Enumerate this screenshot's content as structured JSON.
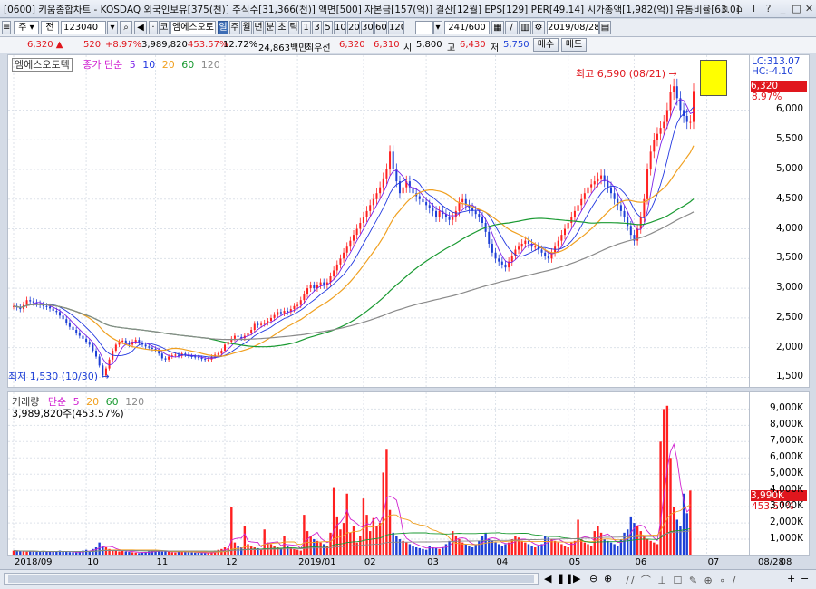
{
  "title_bar": {
    "text": "[0600] 키움종합차트 - KOSDAQ 외국인보유[375(천)] 주식수[31,366(천)] 액면[500] 자본금[157(억)] 결산[12월] EPS[129] PER[49.14] 시가총액[1,982(억)] 유통비율[63.0]",
    "number_label": "1"
  },
  "toolbar": {
    "type_select": "주",
    "all_select": "전",
    "code": "123040",
    "stock_name": "엠에스오토",
    "period_tabs": [
      "일",
      "주",
      "월",
      "년",
      "분",
      "초",
      "틱"
    ],
    "active_period": "일",
    "minute_options": [
      "1",
      "3",
      "5",
      "10",
      "20",
      "30",
      "60",
      "120"
    ],
    "range": "241/600",
    "date": "2019/08/28"
  },
  "quote": {
    "price": "6,320 ▲",
    "change": "520",
    "change_pct": "+8.97%",
    "volume": "3,989,820",
    "volume_ratio": "453.57%",
    "turnover": "12.72%",
    "amount": "24,863백만",
    "best_bid_label": "최우선",
    "best_ask": "6,320",
    "best_bid": "6,310",
    "open_label": "시",
    "open": "5,800",
    "high_label": "고",
    "high": "6,430",
    "low_label": "저",
    "low": "5,750",
    "buy_button": "매수",
    "sell_button": "매도"
  },
  "colors": {
    "up": "#ff2020",
    "down": "#1d3fd6",
    "ma5": "#7b21e8",
    "ma10": "#2137e0",
    "ma20": "#f0a020",
    "ma60": "#1a9a32",
    "ma120": "#8a8a8a",
    "vol_ma": "#d020d0"
  },
  "price_panel": {
    "stock_label": "엠에스오토텍",
    "ma_label": "종가 단순",
    "ma_periods": [
      "5",
      "10",
      "20",
      "60",
      "120"
    ],
    "lc_label": "LC:313.07",
    "hc_label": "HC:-4.10",
    "current_price_tag": "6,320",
    "current_pct_tag": "8.97%",
    "max_marker": "최고 6,590 (08/21)",
    "min_marker": "최저 1,530 (10/30)",
    "y_ticks": [
      "6,000",
      "5,500",
      "5,000",
      "4,500",
      "4,000",
      "3,500",
      "3,000",
      "2,500",
      "2,000",
      "1,500"
    ]
  },
  "volume_panel": {
    "label": "거래량",
    "ma_label": "단순",
    "ma_periods": [
      "5",
      "20",
      "60",
      "120"
    ],
    "current_value": "3,989,820주(453.57%)",
    "current_tag": "3,990K",
    "current_pct_tag": "453.57%",
    "y_ticks": [
      "9,000K",
      "8,000K",
      "7,000K",
      "6,000K",
      "5,000K",
      "4,000K",
      "3,000K",
      "2,000K",
      "1,000K"
    ]
  },
  "x_axis": {
    "labels": [
      "2018/09",
      "10",
      "11",
      "12",
      "2019/01",
      "02",
      "03",
      "04",
      "05",
      "06",
      "07",
      "08"
    ],
    "end_label": "08/28"
  },
  "chart_data": {
    "type": "candlestick",
    "period": "daily",
    "y_range": [
      1400,
      6800
    ],
    "volume_y_range_k": [
      0,
      9800
    ],
    "closes": [
      2700,
      2680,
      2650,
      2720,
      2800,
      2780,
      2760,
      2740,
      2720,
      2700,
      2690,
      2660,
      2620,
      2600,
      2540,
      2480,
      2420,
      2350,
      2300,
      2250,
      2200,
      2150,
      2100,
      2050,
      1950,
      1850,
      1700,
      1530,
      1650,
      1800,
      1950,
      2050,
      2100,
      2120,
      2080,
      2050,
      2100,
      2130,
      2080,
      2050,
      2020,
      2000,
      1980,
      1960,
      1900,
      1820,
      1800,
      1850,
      1870,
      1880,
      1860,
      1900,
      1880,
      1860,
      1850,
      1840,
      1830,
      1810,
      1800,
      1800,
      1850,
      1880,
      1900,
      1950,
      2050,
      2100,
      2150,
      2200,
      2180,
      2160,
      2200,
      2250,
      2300,
      2400,
      2380,
      2400,
      2420,
      2450,
      2500,
      2550,
      2600,
      2580,
      2620,
      2600,
      2650,
      2700,
      2720,
      2800,
      2900,
      3000,
      3050,
      3000,
      3050,
      3100,
      3050,
      3100,
      3200,
      3300,
      3400,
      3500,
      3600,
      3700,
      3800,
      3900,
      4000,
      4100,
      4200,
      4300,
      4400,
      4500,
      4600,
      4700,
      4850,
      5000,
      5300,
      5000,
      4800,
      4600,
      4700,
      4800,
      4700,
      4600,
      4550,
      4500,
      4450,
      4400,
      4350,
      4300,
      4200,
      4300,
      4250,
      4200,
      4150,
      4200,
      4300,
      4450,
      4500,
      4400,
      4350,
      4300,
      4250,
      4200,
      4100,
      3950,
      3750,
      3600,
      3500,
      3450,
      3400,
      3350,
      3450,
      3550,
      3650,
      3700,
      3750,
      3800,
      3750,
      3700,
      3700,
      3650,
      3600,
      3550,
      3500,
      3600,
      3700,
      3800,
      3900,
      4000,
      4100,
      4200,
      4300,
      4400,
      4500,
      4600,
      4700,
      4750,
      4800,
      4850,
      4900,
      4800,
      4700,
      4600,
      4500,
      4400,
      4300,
      4200,
      4050,
      3900,
      3800,
      4000,
      4200,
      4500,
      5000,
      5300,
      5500,
      5600,
      5700,
      5800,
      6000,
      6300,
      6400,
      6200,
      6000,
      5900,
      5800,
      5800,
      6320
    ],
    "volumes_k": [
      300,
      280,
      260,
      250,
      240,
      300,
      250,
      230,
      220,
      260,
      250,
      240,
      230,
      260,
      300,
      250,
      220,
      210,
      200,
      190,
      250,
      300,
      350,
      280,
      400,
      500,
      800,
      600,
      500,
      400,
      350,
      300,
      250,
      300,
      250,
      220,
      200,
      180,
      150,
      200,
      220,
      250,
      300,
      280,
      260,
      240,
      250,
      230,
      200,
      180,
      300,
      250,
      220,
      200,
      190,
      180,
      170,
      160,
      150,
      140,
      200,
      300,
      350,
      400,
      500,
      450,
      3000,
      800,
      600,
      500,
      1800,
      700,
      600,
      500,
      450,
      400,
      1600,
      800,
      700,
      600,
      500,
      450,
      1200,
      600,
      500,
      400,
      350,
      300,
      2500,
      1500,
      1200,
      1000,
      900,
      800,
      700,
      600,
      1400,
      4200,
      2400,
      1600,
      2000,
      3800,
      1400,
      1800,
      800,
      1200,
      3500,
      2500,
      1500,
      2300,
      1800,
      2000,
      5100,
      6500,
      2800,
      1400,
      1200,
      1000,
      900,
      800,
      700,
      600,
      500,
      450,
      400,
      350,
      600,
      500,
      450,
      400,
      500,
      700,
      900,
      1500,
      1200,
      1000,
      800,
      700,
      600,
      500,
      700,
      900,
      1200,
      1400,
      1000,
      900,
      800,
      700,
      600,
      700,
      800,
      1000,
      1200,
      1100,
      900,
      800,
      700,
      600,
      500,
      600,
      700,
      1200,
      1100,
      1000,
      900,
      800,
      700,
      600,
      500,
      800,
      900,
      2200,
      1000,
      800,
      700,
      600,
      1500,
      1800,
      1400,
      1000,
      900,
      800,
      700,
      600,
      1000,
      1400,
      1600,
      2400,
      2000,
      1800,
      1500,
      1200,
      1000,
      900,
      800,
      700,
      7000,
      9000,
      9200,
      6000,
      3000,
      2200,
      1800,
      3800,
      2600,
      3990
    ]
  }
}
